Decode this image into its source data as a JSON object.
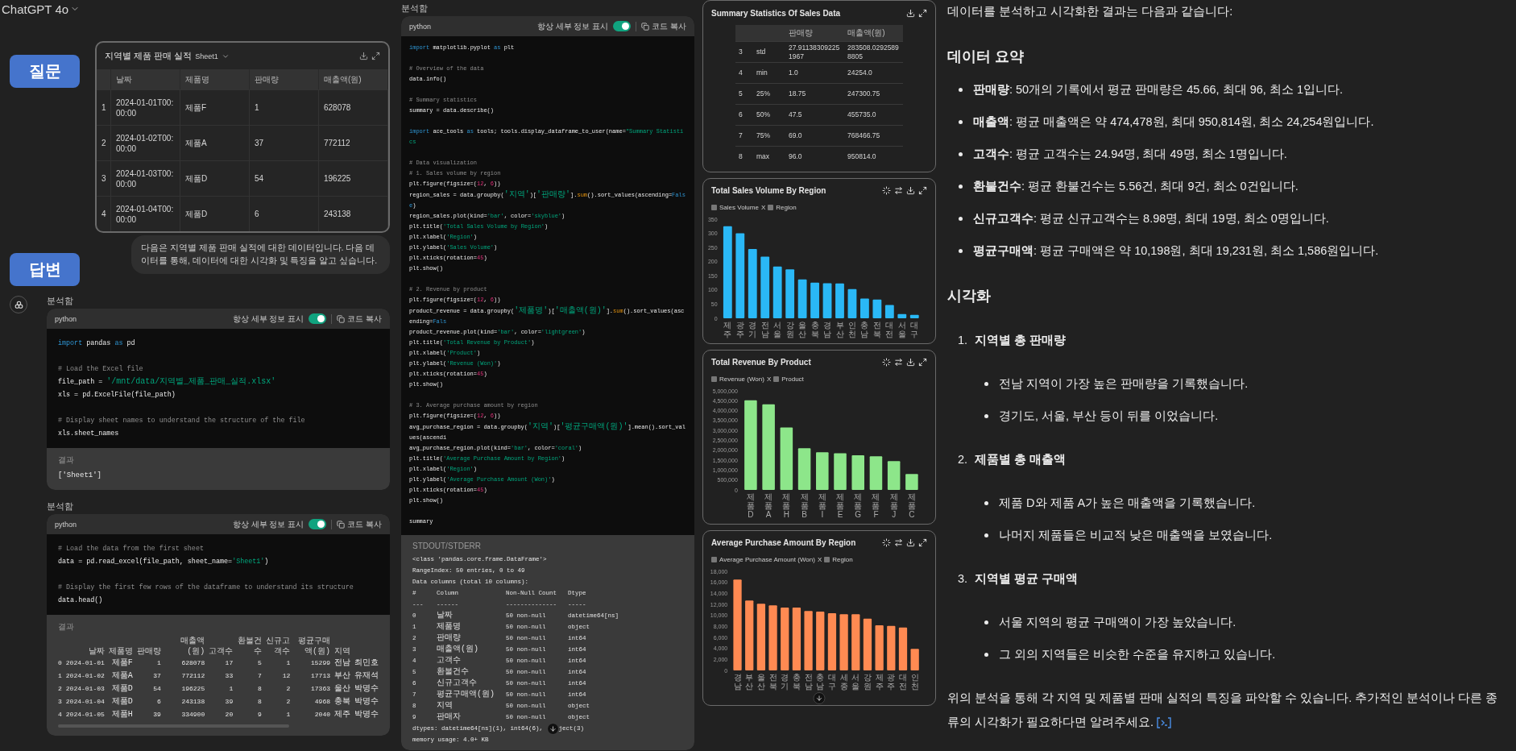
{
  "app": {
    "title": "ChatGPT 4o"
  },
  "labels": {
    "question": "질문",
    "answer": "답변"
  },
  "sheet": {
    "title": "지역별 제품 판매 실적",
    "sheet_name": "Sheet1",
    "columns": [
      "날짜",
      "제품명",
      "판매량",
      "매출액(원)"
    ],
    "rows": [
      {
        "index": "1",
        "cells": [
          "2024-01-01T00:00:00",
          "제품F",
          "1",
          "628078"
        ]
      },
      {
        "index": "2",
        "cells": [
          "2024-01-02T00:00:00",
          "제품A",
          "37",
          "772112"
        ]
      },
      {
        "index": "3",
        "cells": [
          "2024-01-03T00:00:00",
          "제품D",
          "54",
          "196225"
        ]
      },
      {
        "index": "4",
        "cells": [
          "2024-01-04T00:00:00",
          "제품D",
          "6",
          "243138"
        ]
      }
    ]
  },
  "user_message": "다음은 지역별 제품 판매 실적에 대한 데이터입니다. 다음 데이터를 통해, 데이터에 대한 시각화 및 특징을 알고 싶습니다.",
  "analysis_left": [
    {
      "status": "분석함",
      "language": "python",
      "details_label": "항상 세부 정보 표시",
      "details_on": true,
      "copy_label": "코드 복사",
      "paragraphs": [
        [
          [
            {
              "text": "import",
              "kind": "keyword"
            },
            {
              "text": " pandas ",
              "kind": "plain"
            },
            {
              "text": "as",
              "kind": "keyword"
            },
            {
              "text": " pd",
              "kind": "plain"
            }
          ]
        ],
        [
          [
            {
              "text": "# Load the Excel file",
              "kind": "comment"
            }
          ],
          [
            {
              "text": "file_path = ",
              "kind": "plain"
            },
            {
              "text": "'/mnt/data/지역별_제품_판매_실적.xlsx'",
              "kind": "string"
            }
          ],
          [
            {
              "text": "xls = pd.ExcelFile(file_path)",
              "kind": "plain"
            }
          ]
        ],
        [
          [
            {
              "text": "# Display sheet names to understand the structure of the file",
              "kind": "comment"
            }
          ],
          [
            {
              "text": "xls.sheet_names",
              "kind": "plain"
            }
          ]
        ]
      ],
      "result": {
        "kind": "text",
        "label": "결과",
        "output": "['Sheet1']"
      }
    },
    {
      "status": "분석함",
      "language": "python",
      "details_label": "항상 세부 정보 표시",
      "details_on": true,
      "copy_label": "코드 복사",
      "paragraphs": [
        [
          [
            {
              "text": "# Load the data from the first sheet",
              "kind": "comment"
            }
          ],
          [
            {
              "text": "data = pd.read_excel(file_path, sheet_name=",
              "kind": "plain"
            },
            {
              "text": "'Sheet1'",
              "kind": "string"
            },
            {
              "text": ")",
              "kind": "plain"
            }
          ]
        ],
        [
          [
            {
              "text": "# Display the first few rows of the dataframe to understand its structure",
              "kind": "comment"
            }
          ],
          [
            {
              "text": "data.head()",
              "kind": "plain"
            }
          ]
        ]
      ],
      "result": {
        "kind": "dataframe",
        "label": "결과",
        "columns": [
          "",
          "날짜",
          "제품명",
          "판매량",
          "매출액(원)",
          "고객수",
          "환불건수",
          "신규고객수",
          "평균구매액(원)",
          "지역"
        ],
        "rows": [
          [
            "0",
            "2024-01-01",
            "제품F",
            "1",
            "628078",
            "17",
            "5",
            "1",
            "15299",
            "전남",
            "최민호"
          ],
          [
            "1",
            "2024-01-02",
            "제품A",
            "37",
            "772112",
            "33",
            "7",
            "12",
            "17713",
            "부산",
            "유재석"
          ],
          [
            "2",
            "2024-01-03",
            "제품D",
            "54",
            "196225",
            "1",
            "8",
            "2",
            "17363",
            "울산",
            "박명수"
          ],
          [
            "3",
            "2024-01-04",
            "제품D",
            "6",
            "243138",
            "39",
            "8",
            "2",
            "4968",
            "충북",
            "박명수"
          ],
          [
            "4",
            "2024-01-05",
            "제품H",
            "39",
            "334900",
            "20",
            "9",
            "1",
            "2040",
            "제주",
            "박명수"
          ]
        ]
      }
    }
  ],
  "analysis_right": {
    "status": "분석함",
    "language": "python",
    "details_label": "항상 세부 정보 표시",
    "details_on": true,
    "copy_label": "코드 복사",
    "paragraphs": [
      [
        [
          {
            "text": "import",
            "kind": "keyword"
          },
          {
            "text": " matplotlib.pyplot ",
            "kind": "plain"
          },
          {
            "text": "as",
            "kind": "keyword"
          },
          {
            "text": " plt",
            "kind": "plain"
          }
        ]
      ],
      [
        [
          {
            "text": "# Overview of the data",
            "kind": "comment"
          }
        ],
        [
          {
            "text": "data.info()",
            "kind": "plain"
          }
        ]
      ],
      [
        [
          {
            "text": "# Summary statistics",
            "kind": "comment"
          }
        ],
        [
          {
            "text": "summary = data.describe()",
            "kind": "plain"
          }
        ]
      ],
      [
        [
          {
            "text": "import",
            "kind": "keyword"
          },
          {
            "text": " ace_tools ",
            "kind": "plain"
          },
          {
            "text": "as",
            "kind": "keyword"
          },
          {
            "text": " tools; tools.display_dataframe_to_user(name=",
            "kind": "plain"
          },
          {
            "text": "\"Summary Statistics",
            "kind": "string"
          }
        ]
      ],
      [
        [
          {
            "text": "# Data visualization",
            "kind": "comment"
          }
        ],
        [
          {
            "text": "# 1. Sales volume by region",
            "kind": "comment"
          }
        ],
        [
          {
            "text": "plt.figure(figsize=(",
            "kind": "plain"
          },
          {
            "text": "12",
            "kind": "number"
          },
          {
            "text": ", ",
            "kind": "plain"
          },
          {
            "text": "6",
            "kind": "number"
          },
          {
            "text": "))",
            "kind": "plain"
          }
        ],
        [
          {
            "text": "region_sales = data.groupby(",
            "kind": "plain"
          },
          {
            "text": "'지역'",
            "kind": "string"
          },
          {
            "text": ")[",
            "kind": "plain"
          },
          {
            "text": "'판매량'",
            "kind": "string"
          },
          {
            "text": "].",
            "kind": "plain"
          },
          {
            "text": "sum",
            "kind": "builtin"
          },
          {
            "text": "().sort_values(ascending=",
            "kind": "plain"
          },
          {
            "text": "False",
            "kind": "keyword"
          },
          {
            "text": ")",
            "kind": "plain"
          }
        ],
        [
          {
            "text": "region_sales.plot(kind=",
            "kind": "plain"
          },
          {
            "text": "'bar'",
            "kind": "string"
          },
          {
            "text": ", color=",
            "kind": "plain"
          },
          {
            "text": "'skyblue'",
            "kind": "string"
          },
          {
            "text": ")",
            "kind": "plain"
          }
        ],
        [
          {
            "text": "plt.title(",
            "kind": "plain"
          },
          {
            "text": "'Total Sales Volume by Region'",
            "kind": "string"
          },
          {
            "text": ")",
            "kind": "plain"
          }
        ],
        [
          {
            "text": "plt.xlabel(",
            "kind": "plain"
          },
          {
            "text": "'Region'",
            "kind": "string"
          },
          {
            "text": ")",
            "kind": "plain"
          }
        ],
        [
          {
            "text": "plt.ylabel(",
            "kind": "plain"
          },
          {
            "text": "'Sales Volume'",
            "kind": "string"
          },
          {
            "text": ")",
            "kind": "plain"
          }
        ],
        [
          {
            "text": "plt.xticks(rotation=",
            "kind": "plain"
          },
          {
            "text": "45",
            "kind": "number"
          },
          {
            "text": ")",
            "kind": "plain"
          }
        ],
        [
          {
            "text": "plt.show()",
            "kind": "plain"
          }
        ]
      ],
      [
        [
          {
            "text": "# 2. Revenue by product",
            "kind": "comment"
          }
        ],
        [
          {
            "text": "plt.figure(figsize=(",
            "kind": "plain"
          },
          {
            "text": "12",
            "kind": "number"
          },
          {
            "text": ", ",
            "kind": "plain"
          },
          {
            "text": "6",
            "kind": "number"
          },
          {
            "text": "))",
            "kind": "plain"
          }
        ],
        [
          {
            "text": "product_revenue = data.groupby(",
            "kind": "plain"
          },
          {
            "text": "'제품명'",
            "kind": "string"
          },
          {
            "text": ")[",
            "kind": "plain"
          },
          {
            "text": "'매출액(원)'",
            "kind": "string"
          },
          {
            "text": "].",
            "kind": "plain"
          },
          {
            "text": "sum",
            "kind": "builtin"
          },
          {
            "text": "().sort_values(ascending=",
            "kind": "plain"
          },
          {
            "text": "Fals",
            "kind": "keyword"
          }
        ],
        [
          {
            "text": "product_revenue.plot(kind=",
            "kind": "plain"
          },
          {
            "text": "'bar'",
            "kind": "string"
          },
          {
            "text": ", color=",
            "kind": "plain"
          },
          {
            "text": "'lightgreen'",
            "kind": "string"
          },
          {
            "text": ")",
            "kind": "plain"
          }
        ],
        [
          {
            "text": "plt.title(",
            "kind": "plain"
          },
          {
            "text": "'Total Revenue by Product'",
            "kind": "string"
          },
          {
            "text": ")",
            "kind": "plain"
          }
        ],
        [
          {
            "text": "plt.xlabel(",
            "kind": "plain"
          },
          {
            "text": "'Product'",
            "kind": "string"
          },
          {
            "text": ")",
            "kind": "plain"
          }
        ],
        [
          {
            "text": "plt.ylabel(",
            "kind": "plain"
          },
          {
            "text": "'Revenue (Won)'",
            "kind": "string"
          },
          {
            "text": ")",
            "kind": "plain"
          }
        ],
        [
          {
            "text": "plt.xticks(rotation=",
            "kind": "plain"
          },
          {
            "text": "45",
            "kind": "number"
          },
          {
            "text": ")",
            "kind": "plain"
          }
        ],
        [
          {
            "text": "plt.show()",
            "kind": "plain"
          }
        ]
      ],
      [
        [
          {
            "text": "# 3. Average purchase amount by region",
            "kind": "comment"
          }
        ],
        [
          {
            "text": "plt.figure(figsize=(",
            "kind": "plain"
          },
          {
            "text": "12",
            "kind": "number"
          },
          {
            "text": ", ",
            "kind": "plain"
          },
          {
            "text": "6",
            "kind": "number"
          },
          {
            "text": "))",
            "kind": "plain"
          }
        ],
        [
          {
            "text": "avg_purchase_region = data.groupby(",
            "kind": "plain"
          },
          {
            "text": "'지역'",
            "kind": "string"
          },
          {
            "text": ")[",
            "kind": "plain"
          },
          {
            "text": "'평균구매액(원)'",
            "kind": "string"
          },
          {
            "text": "].mean().sort_values(ascendi",
            "kind": "plain"
          }
        ],
        [
          {
            "text": "avg_purchase_region.plot(kind=",
            "kind": "plain"
          },
          {
            "text": "'bar'",
            "kind": "string"
          },
          {
            "text": ", color=",
            "kind": "plain"
          },
          {
            "text": "'coral'",
            "kind": "string"
          },
          {
            "text": ")",
            "kind": "plain"
          }
        ],
        [
          {
            "text": "plt.title(",
            "kind": "plain"
          },
          {
            "text": "'Average Purchase Amount by Region'",
            "kind": "string"
          },
          {
            "text": ")",
            "kind": "plain"
          }
        ],
        [
          {
            "text": "plt.xlabel(",
            "kind": "plain"
          },
          {
            "text": "'Region'",
            "kind": "string"
          },
          {
            "text": ")",
            "kind": "plain"
          }
        ],
        [
          {
            "text": "plt.ylabel(",
            "kind": "plain"
          },
          {
            "text": "'Average Purchase Amount (Won)'",
            "kind": "string"
          },
          {
            "text": ")",
            "kind": "plain"
          }
        ],
        [
          {
            "text": "plt.xticks(rotation=",
            "kind": "plain"
          },
          {
            "text": "45",
            "kind": "number"
          },
          {
            "text": ")",
            "kind": "plain"
          }
        ],
        [
          {
            "text": "plt.show()",
            "kind": "plain"
          }
        ]
      ],
      [
        [
          {
            "text": "summary",
            "kind": "plain"
          }
        ]
      ]
    ],
    "result": {
      "kind": "stdout",
      "label": "STDOUT/STDERR",
      "preamble": [
        "<class 'pandas.core.frame.DataFrame'>",
        "RangeIndex: 50 entries, 0 to 49",
        "Data columns (total 10 columns):"
      ],
      "columns": [
        "#",
        "Column",
        "Non-Null Count",
        "Dtype"
      ],
      "rules": [
        "---",
        "------",
        "--------------",
        "-----"
      ],
      "rows": [
        [
          "0",
          "날짜",
          "50 non-null",
          "datetime64[ns]"
        ],
        [
          "1",
          "제품명",
          "50 non-null",
          "object"
        ],
        [
          "2",
          "판매량",
          "50 non-null",
          "int64"
        ],
        [
          "3",
          "매출액(원)",
          "50 non-null",
          "int64"
        ],
        [
          "4",
          "고객수",
          "50 non-null",
          "int64"
        ],
        [
          "5",
          "환불건수",
          "50 non-null",
          "int64"
        ],
        [
          "6",
          "신규고객수",
          "50 non-null",
          "int64"
        ],
        [
          "7",
          "평균구매액(원)",
          "50 non-null",
          "int64"
        ],
        [
          "8",
          "지역",
          "50 non-null",
          "object"
        ],
        [
          "9",
          "판매자",
          "50 non-null",
          "object"
        ]
      ],
      "footer": [
        {
          "text": "dtypes: datetime64[ns](1), int64(6), ",
          "after": "ject(3)"
        },
        {
          "text": "memory usage: 4.0+ KB"
        }
      ]
    }
  },
  "visuals": [
    {
      "kind": "table",
      "title": "Summary Statistics Of Sales Data",
      "columns": [
        "판매량",
        "매출액(원)"
      ],
      "rows": [
        {
          "index": "3",
          "stat": "std",
          "cells": [
            "27.911383092251967",
            "283508.02925898805"
          ]
        },
        {
          "index": "4",
          "stat": "min",
          "cells": [
            "1.0",
            "24254.0"
          ]
        },
        {
          "index": "5",
          "stat": "25%",
          "cells": [
            "18.75",
            "247300.75"
          ]
        },
        {
          "index": "6",
          "stat": "50%",
          "cells": [
            "47.5",
            "455735.0"
          ]
        },
        {
          "index": "7",
          "stat": "75%",
          "cells": [
            "69.0",
            "768466.75"
          ]
        },
        {
          "index": "8",
          "stat": "max",
          "cells": [
            "96.0",
            "950814.0"
          ]
        }
      ]
    },
    {
      "kind": "chart",
      "title": "Total Sales Volume By Region",
      "legend_joiner": "X",
      "legend_dimension": "Region",
      "chart_data": {
        "type": "bar",
        "categories": [
          "제주",
          "광주",
          "경기",
          "전남",
          "서울",
          "강원",
          "울산",
          "충북",
          "경남",
          "부산",
          "인천",
          "충남",
          "전북",
          "대전",
          "서울",
          "대구"
        ],
        "series": [
          {
            "name": "Sales Volume",
            "color": "#2ab8f6",
            "values": [
              325,
              300,
              245,
              218,
              183,
              173,
              137,
              126,
              124,
              123,
              103,
              70,
              66,
              47,
              15,
              12
            ]
          }
        ],
        "ylim": [
          0,
          350
        ],
        "yticks": [
          0,
          50,
          100,
          150,
          200,
          250,
          300,
          350
        ]
      }
    },
    {
      "kind": "chart",
      "title": "Total Revenue By Product",
      "legend_joiner": "X",
      "legend_dimension": "Product",
      "chart_data": {
        "type": "bar",
        "categories": [
          "제품D",
          "제품A",
          "제품H",
          "제품B",
          "제품I",
          "제품E",
          "제품G",
          "제품F",
          "제품J",
          "제품C"
        ],
        "series": [
          {
            "name": "Revenue (Won)",
            "color": "#8de68a",
            "values": [
              4520000,
              4320000,
              3150000,
              2100000,
              1900000,
              1850000,
              1750000,
              1700000,
              1450000,
              800000
            ]
          }
        ],
        "ylim": [
          0,
          5000000
        ],
        "yticks": [
          {
            "value": 0,
            "label": "0"
          },
          {
            "value": 500000,
            "label": "500,000"
          },
          {
            "value": 1000000,
            "label": "1,000,000"
          },
          {
            "value": 1500000,
            "label": "1,500,000"
          },
          {
            "value": 2000000,
            "label": "2,000,000"
          },
          {
            "value": 2500000,
            "label": "2,500,000"
          },
          {
            "value": 3000000,
            "label": "3,000,000"
          },
          {
            "value": 3500000,
            "label": "3,500,000"
          },
          {
            "value": 4000000,
            "label": "4,000,000"
          },
          {
            "value": 4500000,
            "label": "4,500,000"
          },
          {
            "value": 5000000,
            "label": "5,000,000"
          }
        ]
      }
    },
    {
      "kind": "chart",
      "title": "Average Purchase Amount By Region",
      "legend_joiner": "X",
      "legend_dimension": "Region",
      "chart_data": {
        "type": "bar",
        "categories": [
          "경남",
          "부산",
          "울산",
          "전북",
          "경기",
          "충북",
          "전남",
          "충남",
          "대구",
          "세종",
          "서울",
          "강원",
          "제주",
          "광주",
          "대전",
          "인천"
        ],
        "series": [
          {
            "name": "Average Purchase Amount (Won)",
            "color": "#ff8a52",
            "values": [
              16500,
              12700,
              12100,
              11800,
              11400,
              11400,
              10800,
              10700,
              10400,
              10200,
              10200,
              9400,
              8200,
              8100,
              7800,
              3900
            ]
          }
        ],
        "ylim": [
          0,
          18000
        ],
        "yticks": [
          {
            "value": 0,
            "label": "0"
          },
          {
            "value": 2000,
            "label": "2,000"
          },
          {
            "value": 4000,
            "label": "4,000"
          },
          {
            "value": 6000,
            "label": "6,000"
          },
          {
            "value": 8000,
            "label": "8,000"
          },
          {
            "value": 10000,
            "label": "10,000"
          },
          {
            "value": 12000,
            "label": "12,000"
          },
          {
            "value": 14000,
            "label": "14,000"
          },
          {
            "value": 16000,
            "label": "16,000"
          },
          {
            "value": 18000,
            "label": "18,000"
          }
        ]
      }
    }
  ],
  "response": {
    "intro": "데이터를 분석하고 시각화한 결과는 다음과 같습니다:",
    "summary": {
      "heading": "데이터 요약",
      "bullets": [
        "**판매량**: 50개의 기록에서 평균 판매량은 45.66, 최대 96, 최소 1입니다.",
        "**매출액**: 평균 매출액은 약 474,478원, 최대 950,814원, 최소 24,254원입니다.",
        "**고객수**: 평균 고객수는 24.94명, 최대 49명, 최소 1명입니다.",
        "**환불건수**: 평균 환불건수는 5.56건, 최대 9건, 최소 0건입니다.",
        "**신규고객수**: 평균 신규고객수는 8.98명, 최대 19명, 최소 0명입니다.",
        "**평균구매액**: 평균 구매액은 약 10,198원, 최대 19,231원, 최소 1,586원입니다."
      ]
    },
    "visualization": {
      "heading": "시각화",
      "items": [
        {
          "number": "1.",
          "title": "지역별 총 판매량",
          "bullets": [
            "전남 지역이 가장 높은 판매량을 기록했습니다.",
            "경기도, 서울, 부산 등이 뒤를 이었습니다."
          ]
        },
        {
          "number": "2.",
          "title": "제품별 총 매출액",
          "bullets": [
            "제품 D와 제품 A가 높은 매출액을 기록했습니다.",
            "나머지 제품들은 비교적 낮은 매출액을 보였습니다."
          ]
        },
        {
          "number": "3.",
          "title": "지역별 평균 구매액",
          "bullets": [
            "서울 지역의 평균 구매액이 가장 높았습니다.",
            "그 외의 지역들은 비슷한 수준을 유지하고 있습니다."
          ]
        }
      ]
    },
    "closing": "위의 분석을 통해 각 지역 및 제품별 판매 실적의 특징을 파악할 수 있습니다. 추가적인 분석이나 다른 종류의 시각화가 필요하다면 알려주세요."
  }
}
